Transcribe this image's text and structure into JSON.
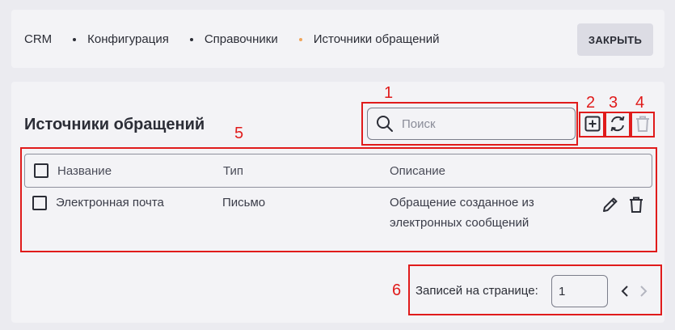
{
  "breadcrumbs": [
    "CRM",
    "Конфигурация",
    "Справочники",
    "Источники обращений"
  ],
  "header": {
    "close_label": "ЗАКРЫТЬ"
  },
  "panel": {
    "title": "Источники обращений"
  },
  "search": {
    "placeholder": "Поиск",
    "value": ""
  },
  "toolbar_icons": [
    "add-icon",
    "refresh-icon",
    "trash-icon"
  ],
  "table": {
    "columns": [
      "Название",
      "Тип",
      "Описание"
    ],
    "rows": [
      {
        "name": "Электронная почта",
        "type": "Письмо",
        "description_line1": "Обращение созданное из",
        "description_line2": "электронных сообщений"
      }
    ]
  },
  "pagination": {
    "label": "Записей на странице:",
    "per_page": "1"
  },
  "annotations": [
    "1",
    "2",
    "3",
    "4",
    "5",
    "6"
  ],
  "colors": {
    "annotation": "#e01b1b",
    "breadcrumb_active_dot": "#f0a55a",
    "background": "#ebebf0",
    "panel": "#f3f3f6"
  }
}
